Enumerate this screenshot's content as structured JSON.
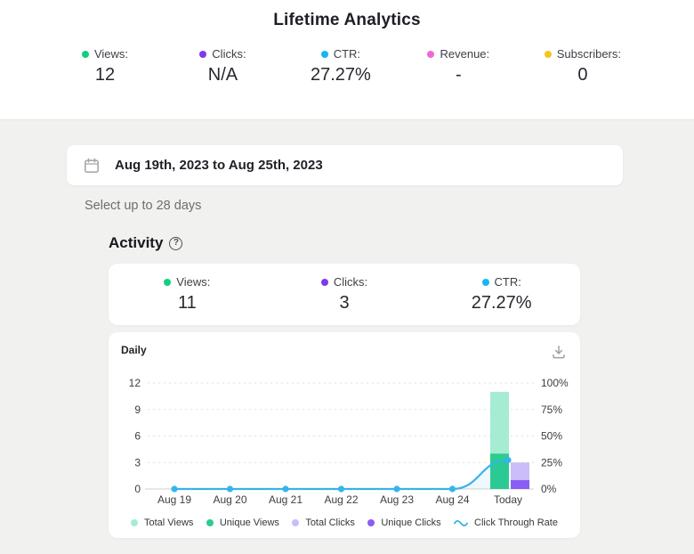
{
  "page": {
    "title": "Lifetime Analytics"
  },
  "lifetime_stats": [
    {
      "label": "Views:",
      "value": "12",
      "color": "#0fd07e"
    },
    {
      "label": "Clicks:",
      "value": "N/A",
      "color": "#7c3aed"
    },
    {
      "label": "CTR:",
      "value": "27.27%",
      "color": "#18b6f0"
    },
    {
      "label": "Revenue:",
      "value": "-",
      "color": "#f266d8"
    },
    {
      "label": "Subscribers:",
      "value": "0",
      "color": "#f7c41f"
    }
  ],
  "date_picker": {
    "value": "Aug 19th, 2023 to Aug 25th, 2023",
    "hint": "Select up to 28 days"
  },
  "activity": {
    "title": "Activity",
    "help_glyph": "?",
    "stats": [
      {
        "label": "Views:",
        "value": "11",
        "color": "#0fd07e"
      },
      {
        "label": "Clicks:",
        "value": "3",
        "color": "#7c3aed"
      },
      {
        "label": "CTR:",
        "value": "27.27%",
        "color": "#18b6f0"
      }
    ]
  },
  "chart_card": {
    "tab": "Daily"
  },
  "chart_data": {
    "type": "bar",
    "title": "Daily activity",
    "categories": [
      "Aug 19",
      "Aug 20",
      "Aug 21",
      "Aug 22",
      "Aug 23",
      "Aug 24",
      "Today"
    ],
    "left_axis": {
      "ticks": [
        0,
        3,
        6,
        9,
        12
      ],
      "range": [
        0,
        12
      ]
    },
    "right_axis": {
      "ticks": [
        "0%",
        "25%",
        "50%",
        "75%",
        "100%"
      ],
      "range": [
        0,
        100
      ]
    },
    "grid": "dashed",
    "legend_position": "bottom",
    "series": [
      {
        "name": "Total Views",
        "type": "bar",
        "axis": "left",
        "color": "#a5ecd2",
        "values": [
          0,
          0,
          0,
          0,
          0,
          0,
          11
        ]
      },
      {
        "name": "Unique Views",
        "type": "bar",
        "axis": "left",
        "color": "#2bcd8e",
        "values": [
          0,
          0,
          0,
          0,
          0,
          0,
          4
        ]
      },
      {
        "name": "Total Clicks",
        "type": "bar",
        "axis": "left",
        "color": "#cbbcfa",
        "values": [
          0,
          0,
          0,
          0,
          0,
          0,
          3
        ]
      },
      {
        "name": "Unique Clicks",
        "type": "bar",
        "axis": "left",
        "color": "#8b5cf6",
        "values": [
          0,
          0,
          0,
          0,
          0,
          0,
          1
        ]
      },
      {
        "name": "Click Through Rate",
        "type": "line",
        "axis": "right",
        "color": "#35b5e9",
        "values": [
          0,
          0,
          0,
          0,
          0,
          0,
          27.27
        ]
      }
    ]
  }
}
